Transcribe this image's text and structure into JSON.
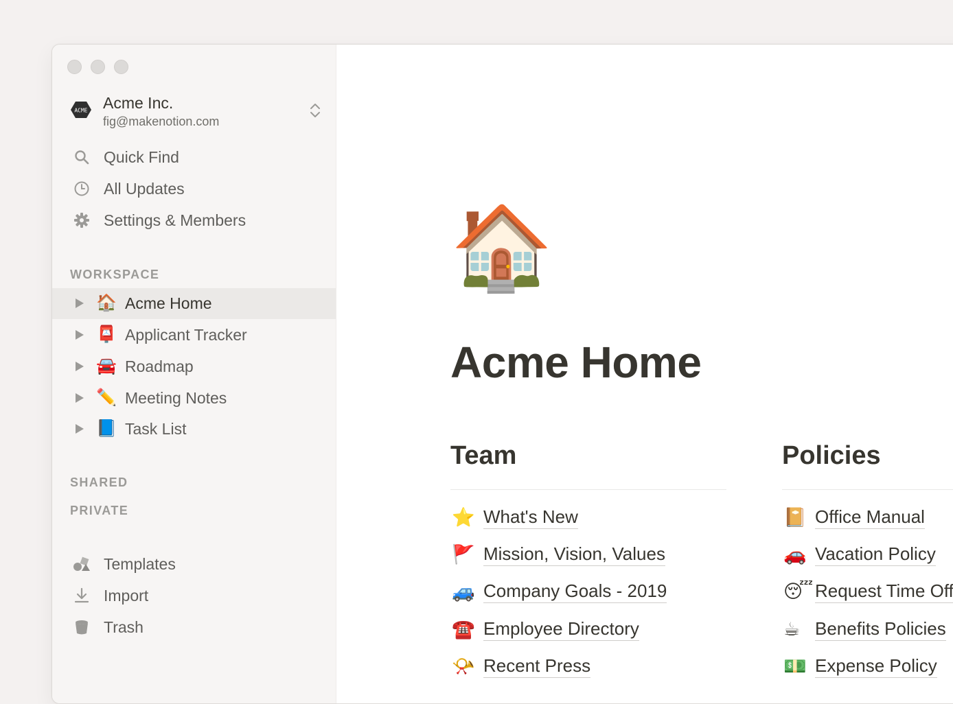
{
  "workspace": {
    "logo_text": "ACME",
    "name": "Acme Inc.",
    "email": "fig@makenotion.com"
  },
  "sidebar": {
    "nav": [
      {
        "label": "Quick Find",
        "icon": "search-icon"
      },
      {
        "label": "All Updates",
        "icon": "clock-icon"
      },
      {
        "label": "Settings & Members",
        "icon": "gear-icon"
      }
    ],
    "workspace_heading": "WORKSPACE",
    "pages": [
      {
        "emoji": "🏠",
        "label": "Acme Home",
        "selected": true
      },
      {
        "emoji": "📮",
        "label": "Applicant Tracker"
      },
      {
        "emoji": "🚘",
        "label": "Roadmap"
      },
      {
        "emoji": "✏️",
        "label": "Meeting Notes"
      },
      {
        "emoji": "📘",
        "label": "Task List"
      }
    ],
    "shared_heading": "SHARED",
    "private_heading": "PRIVATE",
    "bottom": [
      {
        "label": "Templates",
        "icon": "templates-icon"
      },
      {
        "label": "Import",
        "icon": "import-icon"
      },
      {
        "label": "Trash",
        "icon": "trash-icon"
      }
    ]
  },
  "page": {
    "icon": "🏠",
    "title": "Acme Home",
    "columns": [
      {
        "heading": "Team",
        "links": [
          {
            "emoji": "⭐",
            "label": "What's New"
          },
          {
            "emoji": "🚩",
            "label": "Mission, Vision, Values"
          },
          {
            "emoji": "🚙",
            "label": "Company Goals - 2019"
          },
          {
            "emoji": "☎️",
            "label": "Employee Directory"
          },
          {
            "emoji": "📯",
            "label": "Recent Press"
          }
        ]
      },
      {
        "heading": "Policies",
        "links": [
          {
            "emoji": "📔",
            "label": "Office Manual"
          },
          {
            "emoji": "🚗",
            "label": "Vacation Policy"
          },
          {
            "emoji": "😴",
            "label": "Request Time Off"
          },
          {
            "emoji": "☕",
            "label": "Benefits Policies"
          },
          {
            "emoji": "💵",
            "label": "Expense Policy"
          }
        ]
      }
    ]
  }
}
